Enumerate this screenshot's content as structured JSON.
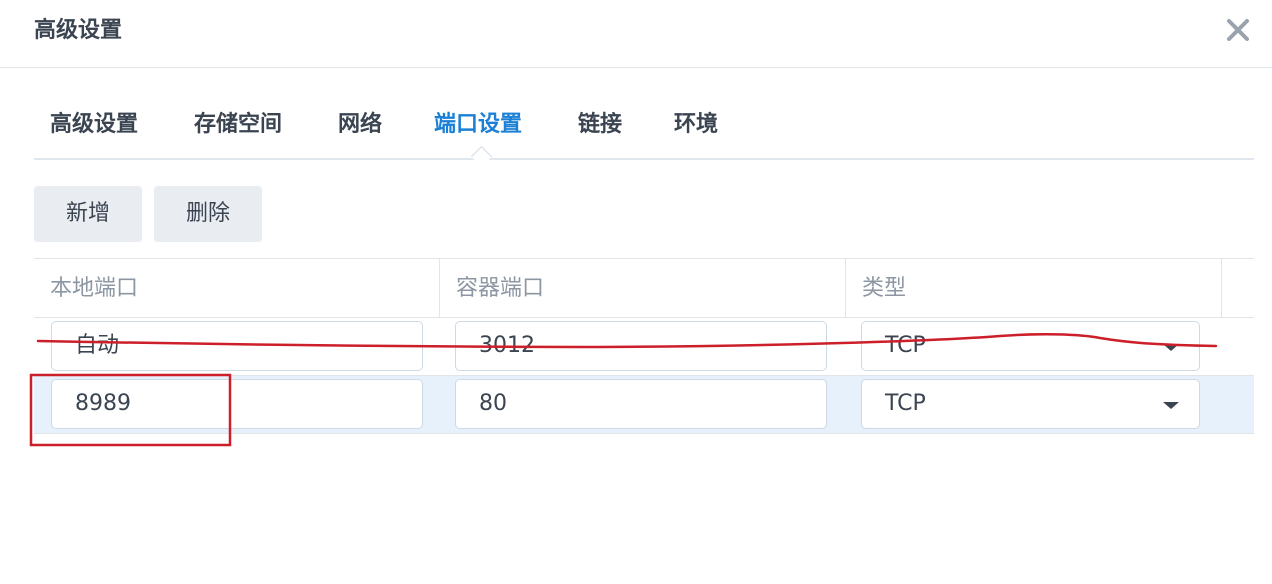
{
  "dialog": {
    "title": "高级设置",
    "close_icon": "close-icon"
  },
  "tabs": [
    {
      "label": "高级设置",
      "active": false
    },
    {
      "label": "存储空间",
      "active": false
    },
    {
      "label": "网络",
      "active": false
    },
    {
      "label": "端口设置",
      "active": true
    },
    {
      "label": "链接",
      "active": false
    },
    {
      "label": "环境",
      "active": false
    }
  ],
  "toolbar": {
    "add_label": "新增",
    "delete_label": "删除"
  },
  "table": {
    "columns": [
      "本地端口",
      "容器端口",
      "类型"
    ],
    "rows": [
      {
        "local_port": "自动",
        "container_port": "3012",
        "type": "TCP",
        "selected": false
      },
      {
        "local_port": "8989",
        "container_port": "80",
        "type": "TCP",
        "selected": true
      }
    ]
  },
  "colors": {
    "accent": "#1b80d6",
    "selected_row": "#e6f1fc",
    "annotation": "#cc1f2a"
  }
}
